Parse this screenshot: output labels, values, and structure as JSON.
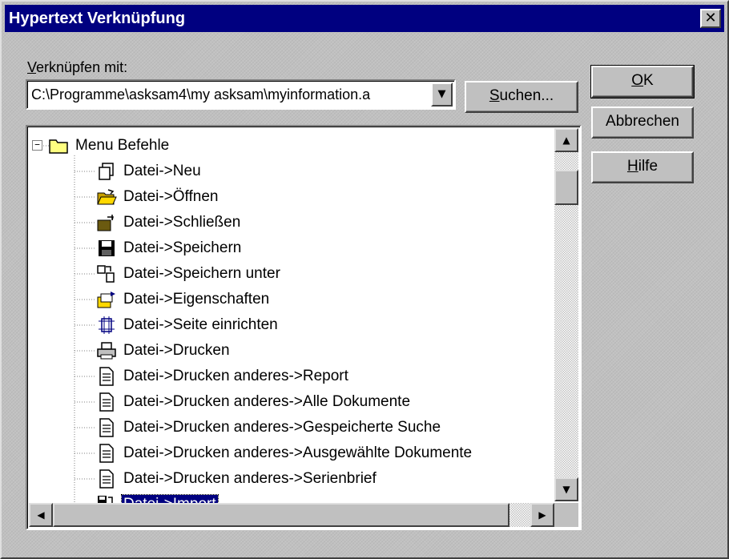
{
  "window": {
    "title": "Hypertext Verknüpfung",
    "close_glyph": "✕"
  },
  "link": {
    "label_accel": "V",
    "label_rest": "erknüpfen mit:",
    "path_value": "C:\\Programme\\asksam4\\my asksam\\myinformation.a",
    "dropdown_glyph": "▼"
  },
  "buttons": {
    "search_accel": "S",
    "search_rest": "uchen...",
    "ok_accel": "O",
    "ok_rest": "K",
    "cancel_label": "Abbrechen",
    "help_accel": "H",
    "help_rest": "ilfe"
  },
  "tree": {
    "root": {
      "label": "Menu Befehle",
      "icon": "folder-open-icon",
      "expander": "−"
    },
    "items": [
      {
        "label": "Datei->Neu",
        "icon": "new-document-icon"
      },
      {
        "label": "Datei->Öffnen",
        "icon": "open-folder-icon"
      },
      {
        "label": "Datei->Schließen",
        "icon": "close-folder-icon"
      },
      {
        "label": "Datei->Speichern",
        "icon": "floppy-disk-icon"
      },
      {
        "label": "Datei->Speichern unter",
        "icon": "save-as-icon"
      },
      {
        "label": "Datei->Eigenschaften",
        "icon": "properties-icon"
      },
      {
        "label": "Datei->Seite einrichten",
        "icon": "page-setup-icon"
      },
      {
        "label": "Datei->Drucken",
        "icon": "printer-icon"
      },
      {
        "label": "Datei->Drucken anderes->Report",
        "icon": "document-icon"
      },
      {
        "label": "Datei->Drucken anderes->Alle Dokumente",
        "icon": "document-icon"
      },
      {
        "label": "Datei->Drucken anderes->Gespeicherte Suche",
        "icon": "document-icon"
      },
      {
        "label": "Datei->Drucken anderes->Ausgewählte Dokumente",
        "icon": "document-icon"
      },
      {
        "label": "Datei->Drucken anderes->Serienbrief",
        "icon": "document-icon"
      },
      {
        "label": "Datei->Import",
        "icon": "import-icon",
        "selected": true
      }
    ]
  },
  "scrollbars": {
    "up": "▲",
    "down": "▼",
    "left": "◀",
    "right": "▶"
  },
  "colors": {
    "titlebar": "#000080",
    "selection": "#000080",
    "face": "#c0c0c0"
  }
}
